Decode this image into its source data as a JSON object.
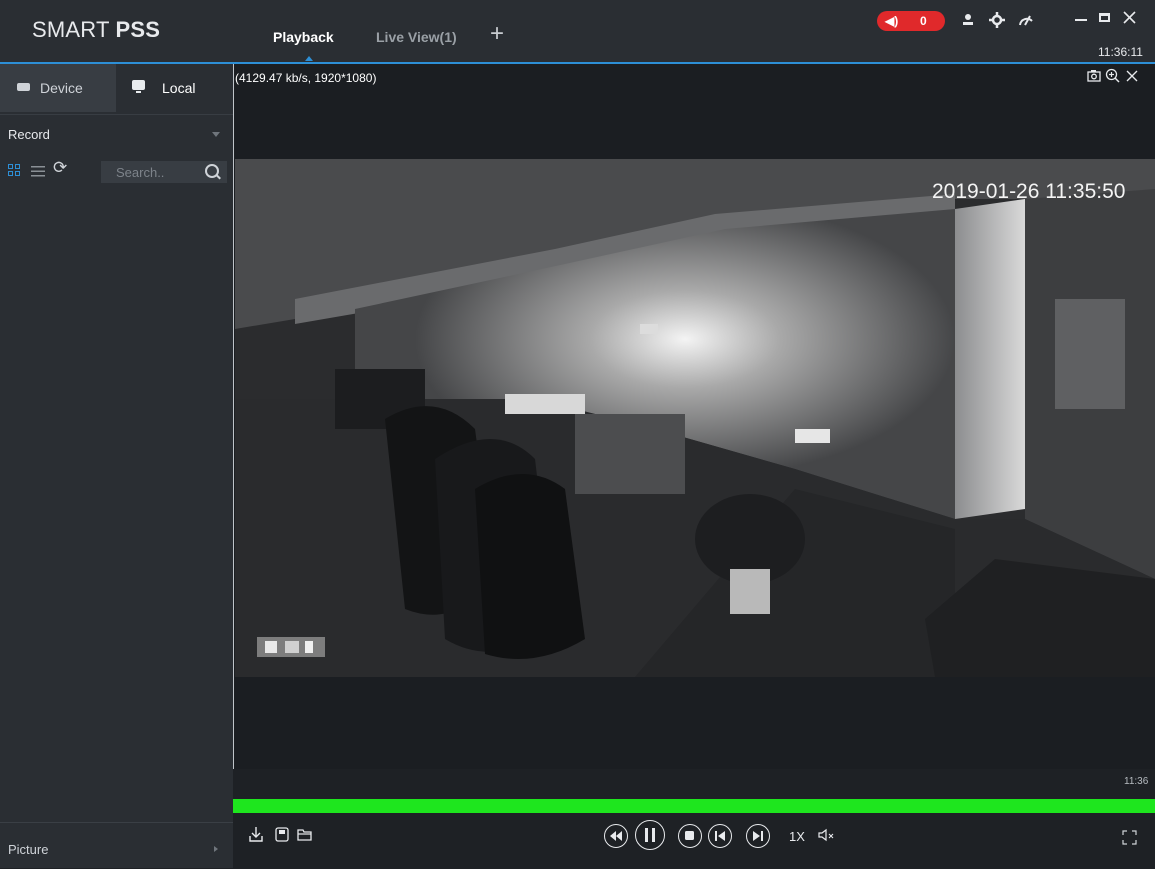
{
  "app": {
    "logo_light": "SMART ",
    "logo_bold": "PSS"
  },
  "tabs": [
    {
      "label": "Playback",
      "active": true
    },
    {
      "label": "Live View(1)",
      "active": false
    }
  ],
  "topbar": {
    "alarm_count": "0",
    "clock": "11:36:11",
    "icons": [
      "speaker-icon",
      "user-icon",
      "settings-icon",
      "performance-icon",
      "minimize-icon",
      "maximize-icon",
      "close-icon"
    ]
  },
  "sidebar": {
    "tabs": [
      {
        "label": "Device",
        "icon": "device-icon"
      },
      {
        "label": "Local",
        "icon": "monitor-icon"
      }
    ],
    "record_select": "Record",
    "search_placeholder": "Search..",
    "bottom_item": "Picture"
  },
  "video": {
    "info": "(4129.47 kb/s, 1920*1080)",
    "timestamp": "2019-01-26 11:35:50",
    "tools": [
      "snapshot-icon",
      "zoom-icon",
      "close-icon"
    ]
  },
  "timeline": {
    "time_label": "11:36",
    "progress_fraction": 1.0
  },
  "controls": {
    "speed": "1X",
    "buttons": [
      "rewind-icon",
      "pause-icon",
      "stop-icon",
      "prev-frame-icon",
      "next-frame-icon"
    ],
    "left_buttons": [
      "download-icon",
      "save-icon",
      "folder-icon"
    ]
  },
  "colors": {
    "accent": "#2d8fd6",
    "alarm": "#e0292b",
    "progress": "#1ee61e",
    "panel": "#2a2e33"
  }
}
